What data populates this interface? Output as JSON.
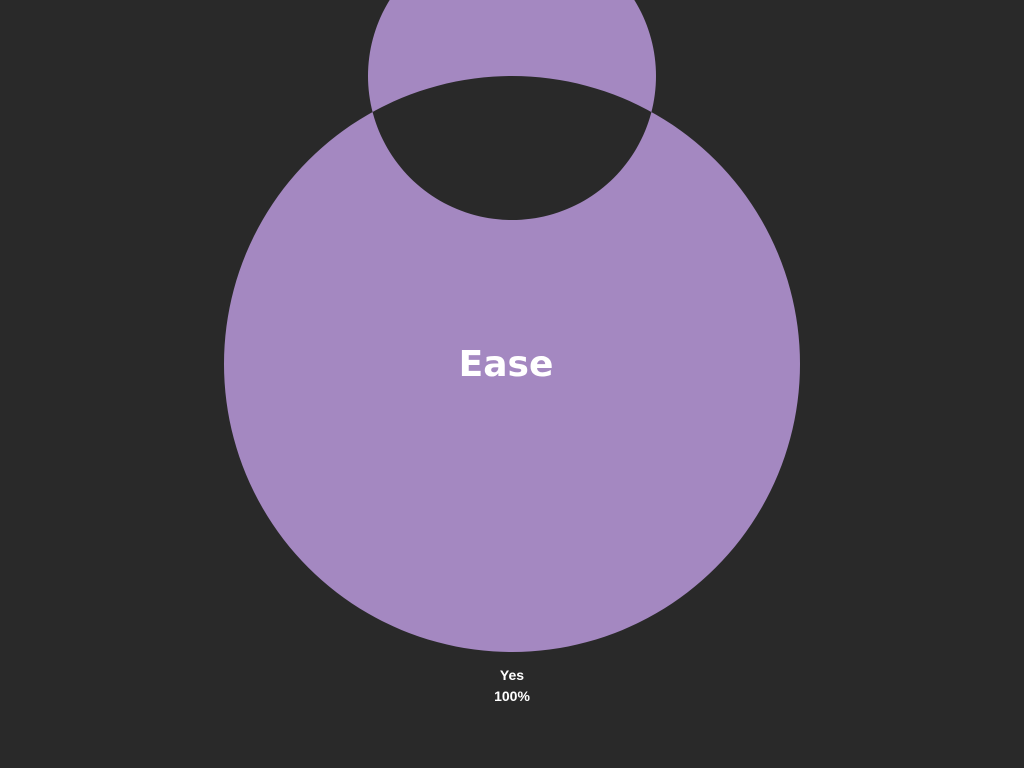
{
  "chart_data": {
    "type": "pie",
    "title": "Ease",
    "categories": [
      "Yes"
    ],
    "values": [
      100
    ],
    "value_labels": [
      "100%"
    ],
    "colors": [
      "#a488c1"
    ],
    "background": "#292929",
    "legend": "none"
  }
}
